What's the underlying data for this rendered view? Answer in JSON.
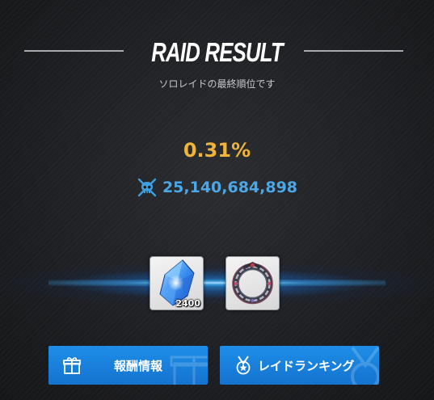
{
  "header": {
    "title": "RAID RESULT",
    "subtitle": "ソロレイドの最終順位です"
  },
  "result": {
    "rank_percent": "0.31%",
    "score": "25,140,684,898",
    "score_icon": "skull-crossed-swords-icon"
  },
  "rewards": [
    {
      "icon": "blue-crystal-icon",
      "quantity": "2400"
    },
    {
      "icon": "ornate-ring-icon",
      "quantity": ""
    }
  ],
  "buttons": {
    "reward_info": {
      "label": "報酬情報",
      "icon": "gift-icon"
    },
    "raid_ranking": {
      "label": "レイドランキング",
      "icon": "medal-icon"
    }
  },
  "colors": {
    "accent_gold": "#f0b43a",
    "score_blue": "#4aa8e8",
    "button_blue": "#1a82dc",
    "background": "#1e1f22"
  }
}
